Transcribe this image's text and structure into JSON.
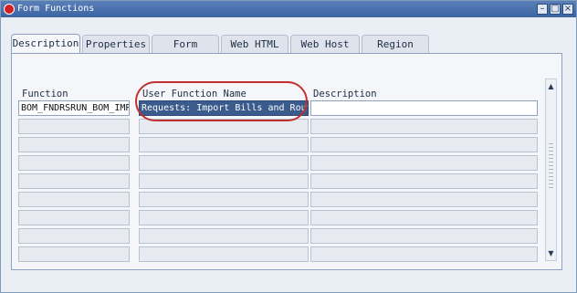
{
  "window": {
    "title": "Form Functions"
  },
  "tabs": [
    {
      "label": "Description",
      "active": true
    },
    {
      "label": "Properties",
      "active": false
    },
    {
      "label": "Form",
      "active": false
    },
    {
      "label": "Web HTML",
      "active": false
    },
    {
      "label": "Web Host",
      "active": false
    },
    {
      "label": "Region",
      "active": false
    }
  ],
  "columns": {
    "function": "Function",
    "user_function_name": "User Function Name",
    "description": "Description"
  },
  "rows": [
    {
      "function": "BOM_FNDRSRUN_BOM_IMPO",
      "user_function_name": "Requests: Import Bills and Rout",
      "description": ""
    }
  ],
  "colors": {
    "titlebar": "#3d64a3",
    "selection": "#3b5b8d",
    "highlight_oval": "#c0302c"
  }
}
